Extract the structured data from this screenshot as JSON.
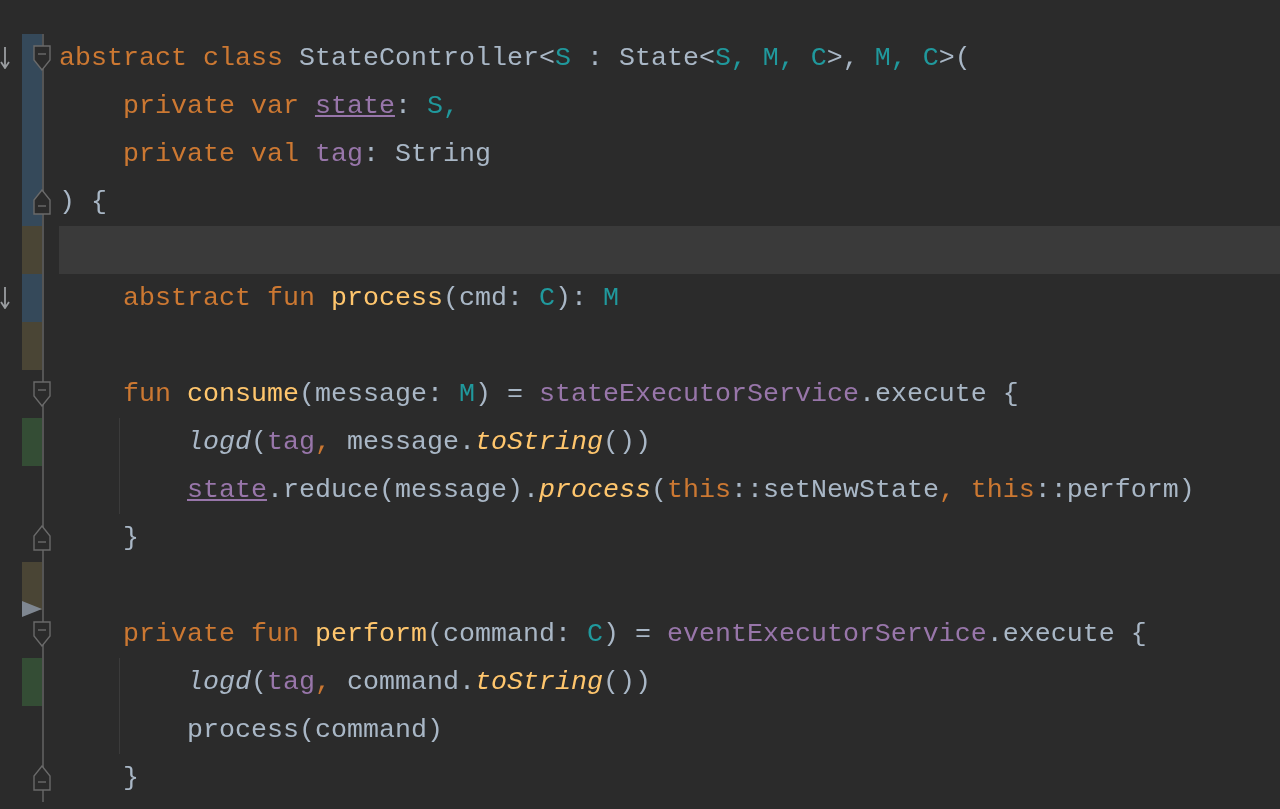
{
  "editor": {
    "lines": [
      {
        "change_marker": {
          "color": "#35495a"
        },
        "gutter_icon": {
          "kind": "override"
        },
        "fold_marker": {
          "kind": "start"
        },
        "tokens": [
          {
            "text": "abstract class",
            "kind": "keyword"
          },
          {
            "text": " StateController<",
            "kind": "plain"
          },
          {
            "text": "S",
            "kind": "type"
          },
          {
            "text": " : State<",
            "kind": "plain"
          },
          {
            "text": "S, M, C",
            "kind": "type"
          },
          {
            "text": ">, ",
            "kind": "plain"
          },
          {
            "text": "M, C",
            "kind": "type"
          },
          {
            "text": ">(",
            "kind": "plain"
          }
        ],
        "children": [
          {
            "change_marker": {
              "color": "#35495a"
            },
            "tokens": [
              {
                "text": "private var ",
                "kind": "keyword"
              },
              {
                "text": "state",
                "kind": "mutable"
              },
              {
                "text": ": ",
                "kind": "plain"
              },
              {
                "text": "S,",
                "kind": "type"
              }
            ]
          },
          {
            "change_marker": {
              "color": "#35495a"
            },
            "tokens": [
              {
                "text": "private val ",
                "kind": "keyword"
              },
              {
                "text": "tag",
                "kind": "property"
              },
              {
                "text": ": String",
                "kind": "plain"
              }
            ]
          }
        ]
      },
      {
        "change_marker": {
          "color": "#35495a"
        },
        "fold_marker": {
          "kind": "end"
        },
        "tokens": [
          {
            "text": ") {",
            "kind": "plain"
          }
        ],
        "children": [
          {
            "current": true,
            "change_marker": {
              "color": "#4a4535"
            }
          },
          {
            "change_marker": {
              "color": "#35495a"
            },
            "gutter_icon": {
              "kind": "override"
            },
            "tokens": [
              {
                "text": "abstract fun ",
                "kind": "keyword"
              },
              {
                "text": "process",
                "kind": "declaration"
              },
              {
                "text": "(cmd: ",
                "kind": "plain"
              },
              {
                "text": "C",
                "kind": "type"
              },
              {
                "text": "): ",
                "kind": "plain"
              },
              {
                "text": "M",
                "kind": "type"
              }
            ]
          },
          {
            "change_marker": {
              "color": "#4a4535"
            }
          },
          {
            "fold_marker": {
              "kind": "start"
            },
            "tokens": [
              {
                "text": "fun ",
                "kind": "keyword"
              },
              {
                "text": "consume",
                "kind": "declaration"
              },
              {
                "text": "(message: ",
                "kind": "plain"
              },
              {
                "text": "M",
                "kind": "type"
              },
              {
                "text": ") = ",
                "kind": "plain"
              },
              {
                "text": "stateExecutorService",
                "kind": "property"
              },
              {
                "text": ".execute {",
                "kind": "plain"
              }
            ],
            "children": [
              {
                "change_marker": {
                  "color": "#344d35"
                },
                "tokens": [
                  {
                    "text": "logd",
                    "kind": "extension"
                  },
                  {
                    "text": "(",
                    "kind": "plain"
                  },
                  {
                    "text": "tag",
                    "kind": "property"
                  },
                  {
                    "text": ", ",
                    "kind": "keyword"
                  },
                  {
                    "text": "message.",
                    "kind": "plain"
                  },
                  {
                    "text": "toString",
                    "kind": "call"
                  },
                  {
                    "text": "())",
                    "kind": "plain"
                  }
                ]
              },
              {
                "tokens": [
                  {
                    "text": "state",
                    "kind": "mutable"
                  },
                  {
                    "text": ".reduce(message).",
                    "kind": "plain"
                  },
                  {
                    "text": "process",
                    "kind": "call"
                  },
                  {
                    "text": "(",
                    "kind": "plain"
                  },
                  {
                    "text": "this",
                    "kind": "keyword"
                  },
                  {
                    "text": "::setNewState",
                    "kind": "plain"
                  },
                  {
                    "text": ", this",
                    "kind": "keyword"
                  },
                  {
                    "text": "::perform)",
                    "kind": "plain"
                  }
                ]
              }
            ]
          },
          {
            "fold_marker": {
              "kind": "end"
            },
            "tokens": [
              {
                "text": "}",
                "kind": "plain"
              }
            ]
          },
          {
            "change_marker": {
              "color": "#4a4535"
            },
            "gutter_icon": {
              "kind": "triangle"
            }
          },
          {
            "fold_marker": {
              "kind": "start"
            },
            "tokens": [
              {
                "text": "private fun ",
                "kind": "keyword"
              },
              {
                "text": "perform",
                "kind": "declaration"
              },
              {
                "text": "(command: ",
                "kind": "plain"
              },
              {
                "text": "C",
                "kind": "type"
              },
              {
                "text": ") = ",
                "kind": "plain"
              },
              {
                "text": "eventExecutorService",
                "kind": "property"
              },
              {
                "text": ".execute {",
                "kind": "plain"
              }
            ],
            "children": [
              {
                "change_marker": {
                  "color": "#344d35"
                },
                "tokens": [
                  {
                    "text": "logd",
                    "kind": "extension"
                  },
                  {
                    "text": "(",
                    "kind": "plain"
                  },
                  {
                    "text": "tag",
                    "kind": "property"
                  },
                  {
                    "text": ", ",
                    "kind": "keyword"
                  },
                  {
                    "text": "command.",
                    "kind": "plain"
                  },
                  {
                    "text": "toString",
                    "kind": "call"
                  },
                  {
                    "text": "())",
                    "kind": "plain"
                  }
                ]
              },
              {
                "tokens": [
                  {
                    "text": "process(command)",
                    "kind": "plain"
                  }
                ]
              }
            ]
          },
          {
            "fold_marker": {
              "kind": "end"
            },
            "tokens": [
              {
                "text": "}",
                "kind": "plain"
              }
            ]
          }
        ]
      }
    ]
  }
}
